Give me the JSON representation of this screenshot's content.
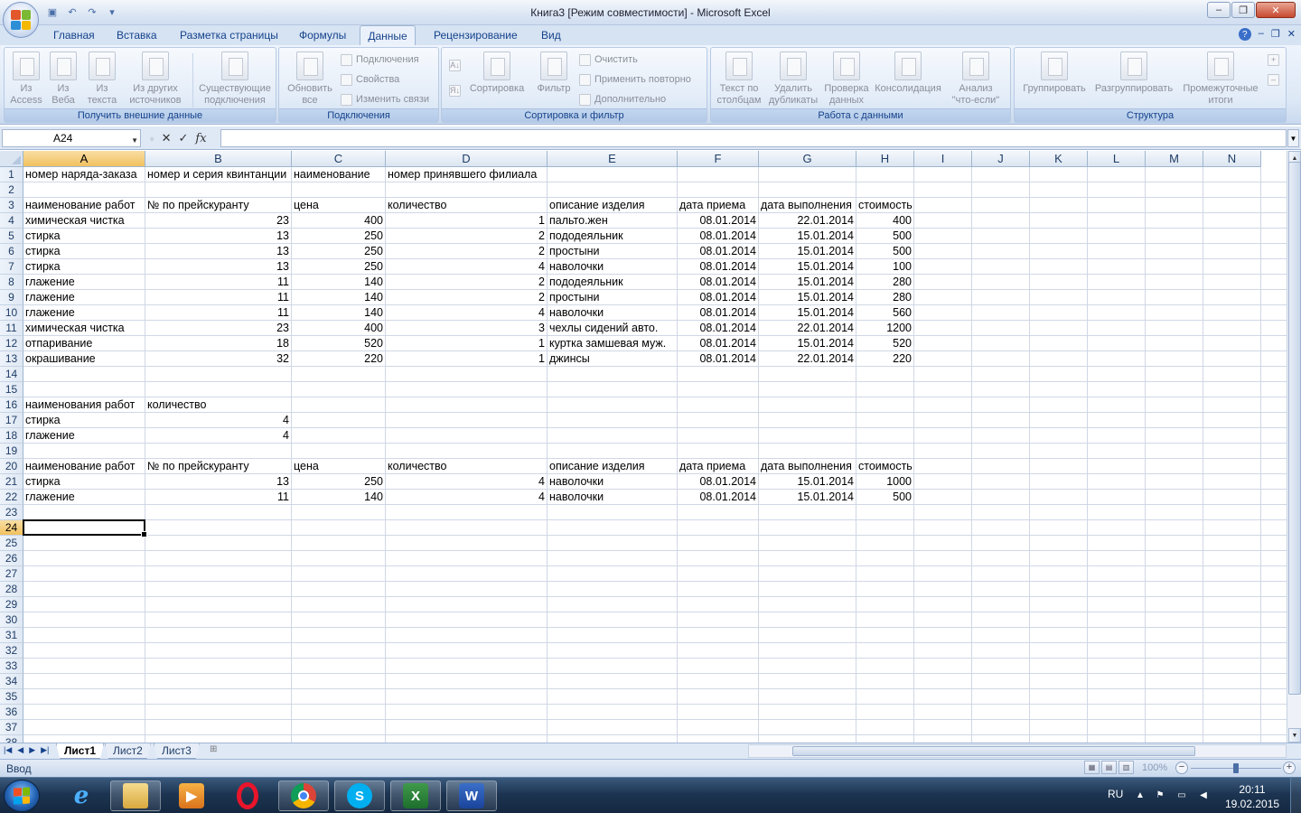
{
  "window": {
    "title": "Книга3  [Режим совместимости] - Microsoft Excel",
    "controls": {
      "minimize": "–",
      "restore": "❐",
      "close": "✕"
    }
  },
  "ribbon_tabs": [
    "Главная",
    "Вставка",
    "Разметка страницы",
    "Формулы",
    "Данные",
    "Рецензирование",
    "Вид"
  ],
  "active_tab": "Данные",
  "ribbon": {
    "groups": {
      "external": "Получить внешние данные",
      "connections": "Подключения",
      "sort_filter": "Сортировка и фильтр",
      "data_tools": "Работа с данными",
      "outline": "Структура"
    },
    "buttons": {
      "from_access": [
        "Из",
        "Access"
      ],
      "from_web": [
        "Из",
        "Веба"
      ],
      "from_text": [
        "Из",
        "текста"
      ],
      "from_other": [
        "Из других",
        "источников"
      ],
      "existing": [
        "Существующие",
        "подключения"
      ],
      "refresh_all": [
        "Обновить",
        "все"
      ],
      "connections": "Подключения",
      "properties": "Свойства",
      "edit_links": "Изменить связи",
      "sort": "Сортировка",
      "filter": "Фильтр",
      "clear": "Очистить",
      "reapply": "Применить повторно",
      "advanced": "Дополнительно",
      "text_to_columns": [
        "Текст по",
        "столбцам"
      ],
      "remove_dupes": [
        "Удалить",
        "дубликаты"
      ],
      "validation": [
        "Проверка",
        "данных"
      ],
      "consolidate": "Консолидация",
      "whatif": [
        "Анализ",
        "\"что-если\""
      ],
      "group": "Группировать",
      "ungroup": "Разгруппировать",
      "subtotal": [
        "Промежуточные",
        "итоги"
      ]
    }
  },
  "formula_bar": {
    "name_box": "A24",
    "formula": ""
  },
  "sheet": {
    "columns": [
      "A",
      "B",
      "C",
      "D",
      "E",
      "F",
      "G",
      "H",
      "I",
      "J",
      "K",
      "L",
      "M",
      "N"
    ],
    "selected_cell": "A24",
    "rows": [
      [
        "номер наряда-заказа",
        "номер и серия квинтанции",
        "наименование",
        "номер принявшего филиала",
        "",
        "",
        "",
        ""
      ],
      [
        "",
        "",
        "",
        "",
        "",
        "",
        "",
        ""
      ],
      [
        "наименование работ",
        "№ по прейскуранту",
        "цена",
        "количество",
        "описание изделия",
        "дата приема",
        "дата выполнения",
        "стоимость"
      ],
      [
        "химическая чистка",
        "23",
        "400",
        "1",
        "пальто.жен",
        "08.01.2014",
        "22.01.2014",
        "400"
      ],
      [
        "стирка",
        "13",
        "250",
        "2",
        "пододеяльник",
        "08.01.2014",
        "15.01.2014",
        "500"
      ],
      [
        "стирка",
        "13",
        "250",
        "2",
        "простыни",
        "08.01.2014",
        "15.01.2014",
        "500"
      ],
      [
        "стирка",
        "13",
        "250",
        "4",
        "наволочки",
        "08.01.2014",
        "15.01.2014",
        "100"
      ],
      [
        "глажение",
        "11",
        "140",
        "2",
        "пододеяльник",
        "08.01.2014",
        "15.01.2014",
        "280"
      ],
      [
        "глажение",
        "11",
        "140",
        "2",
        "простыни",
        "08.01.2014",
        "15.01.2014",
        "280"
      ],
      [
        "глажение",
        "11",
        "140",
        "4",
        "наволочки",
        "08.01.2014",
        "15.01.2014",
        "560"
      ],
      [
        "химическая чистка",
        "23",
        "400",
        "3",
        "чехлы сидений авто.",
        "08.01.2014",
        "22.01.2014",
        "1200"
      ],
      [
        "отпаривание",
        "18",
        "520",
        "1",
        "куртка замшевая муж.",
        "08.01.2014",
        "15.01.2014",
        "520"
      ],
      [
        "окрашивание",
        "32",
        "220",
        "1",
        "джинсы",
        "08.01.2014",
        "22.01.2014",
        "220"
      ],
      [
        "",
        "",
        "",
        "",
        "",
        "",
        "",
        ""
      ],
      [
        "",
        "",
        "",
        "",
        "",
        "",
        "",
        ""
      ],
      [
        "наименования работ",
        "количество",
        "",
        "",
        "",
        "",
        "",
        ""
      ],
      [
        "стирка",
        "4",
        "",
        "",
        "",
        "",
        "",
        ""
      ],
      [
        "глажение",
        "4",
        "",
        "",
        "",
        "",
        "",
        ""
      ],
      [
        "",
        "",
        "",
        "",
        "",
        "",
        "",
        ""
      ],
      [
        "наименование работ",
        "№ по прейскуранту",
        "цена",
        "количество",
        "описание изделия",
        "дата приема",
        "дата выполнения",
        "стоимость"
      ],
      [
        "стирка",
        "13",
        "250",
        "4",
        "наволочки",
        "08.01.2014",
        "15.01.2014",
        "1000"
      ],
      [
        "глажение",
        "11",
        "140",
        "4",
        "наволочки",
        "08.01.2014",
        "15.01.2014",
        "500"
      ]
    ]
  },
  "sheet_tabs": [
    "Лист1",
    "Лист2",
    "Лист3"
  ],
  "active_sheet": "Лист1",
  "status": {
    "mode": "Ввод",
    "zoom": "100%"
  },
  "taskbar": {
    "apps": [
      "Internet Explorer",
      "Проводник",
      "Media Player",
      "Opera",
      "Chrome",
      "Skype",
      "Excel",
      "Word"
    ],
    "lang": "RU",
    "time": "20:11",
    "date": "19.02.2015"
  }
}
